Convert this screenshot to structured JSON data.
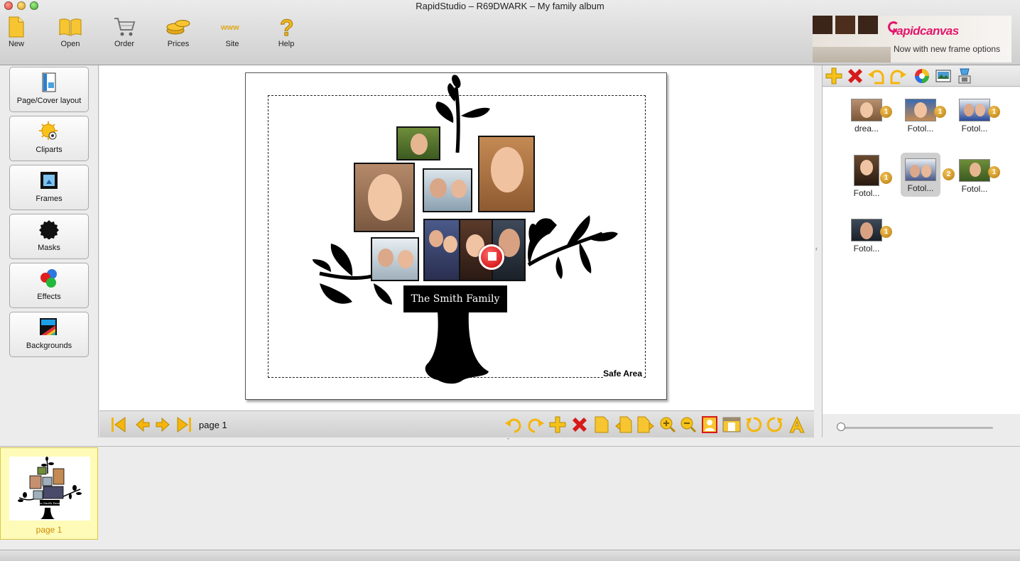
{
  "window": {
    "title": "RapidStudio – R69DWARK – My family album"
  },
  "toolbar": {
    "items": [
      {
        "label": "New",
        "icon": "new-document-icon"
      },
      {
        "label": "Open",
        "icon": "open-book-icon"
      },
      {
        "label": "Order",
        "icon": "shopping-cart-icon"
      },
      {
        "label": "Prices",
        "icon": "coins-icon"
      },
      {
        "label": "Site",
        "icon": "www-icon"
      },
      {
        "label": "Help",
        "icon": "question-mark-icon"
      }
    ]
  },
  "ad": {
    "brand": "rapidcanvas",
    "tagline": "Now with new frame options"
  },
  "left_panel": {
    "buttons": [
      {
        "label": "Page/Cover layout",
        "icon": "page-layout-icon"
      },
      {
        "label": "Cliparts",
        "icon": "clipart-sun-icon"
      },
      {
        "label": "Frames",
        "icon": "frame-icon"
      },
      {
        "label": "Masks",
        "icon": "mask-icon"
      },
      {
        "label": "Effects",
        "icon": "effects-icon"
      },
      {
        "label": "Backgrounds",
        "icon": "backgrounds-icon"
      }
    ]
  },
  "canvas": {
    "caption": "The Smith Family",
    "safe_area_label": "Safe Area"
  },
  "navigation": {
    "page_label": "page 1"
  },
  "photos": [
    {
      "name": "drea...",
      "count": "1"
    },
    {
      "name": "Fotol...",
      "count": "1"
    },
    {
      "name": "Fotol...",
      "count": "1"
    },
    {
      "name": "Fotol...",
      "count": "1"
    },
    {
      "name": "Fotol...",
      "count": "2",
      "selected": true
    },
    {
      "name": "Fotol...",
      "count": "1"
    },
    {
      "name": "Fotol...",
      "count": "1"
    }
  ],
  "filmstrip": {
    "pages": [
      {
        "label": "page 1",
        "selected": true
      }
    ],
    "mini_caption": "The Smith Family"
  },
  "colors": {
    "accent_yellow": "#f5b50a",
    "delete_red": "#d61a1a",
    "ad_pink": "#e4166b",
    "selected_page": "#fdfbb7"
  }
}
